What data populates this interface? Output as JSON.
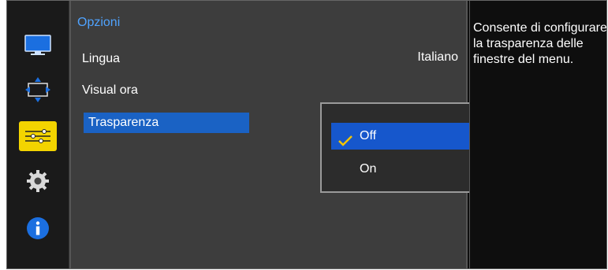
{
  "sidebar": {
    "items": [
      {
        "icon": "monitor-icon"
      },
      {
        "icon": "screen-adjust-icon"
      },
      {
        "icon": "options-sliders-icon"
      },
      {
        "icon": "gear-icon"
      },
      {
        "icon": "info-icon"
      }
    ],
    "active_index": 2
  },
  "menu": {
    "title": "Opzioni",
    "items": [
      {
        "label": "Lingua",
        "value": "Italiano"
      },
      {
        "label": "Visual ora"
      },
      {
        "label": "Trasparenza"
      }
    ]
  },
  "popup": {
    "options": [
      {
        "label": "Off",
        "selected": true
      },
      {
        "label": "On",
        "selected": false
      }
    ]
  },
  "description": "Consente di configurare la trasparenza delle finestre del menu.",
  "colors": {
    "accent_blue": "#1a62c4",
    "title_blue": "#4fa3ff",
    "check_yellow": "#f2c400",
    "panel_gray": "#3d3d3d"
  }
}
